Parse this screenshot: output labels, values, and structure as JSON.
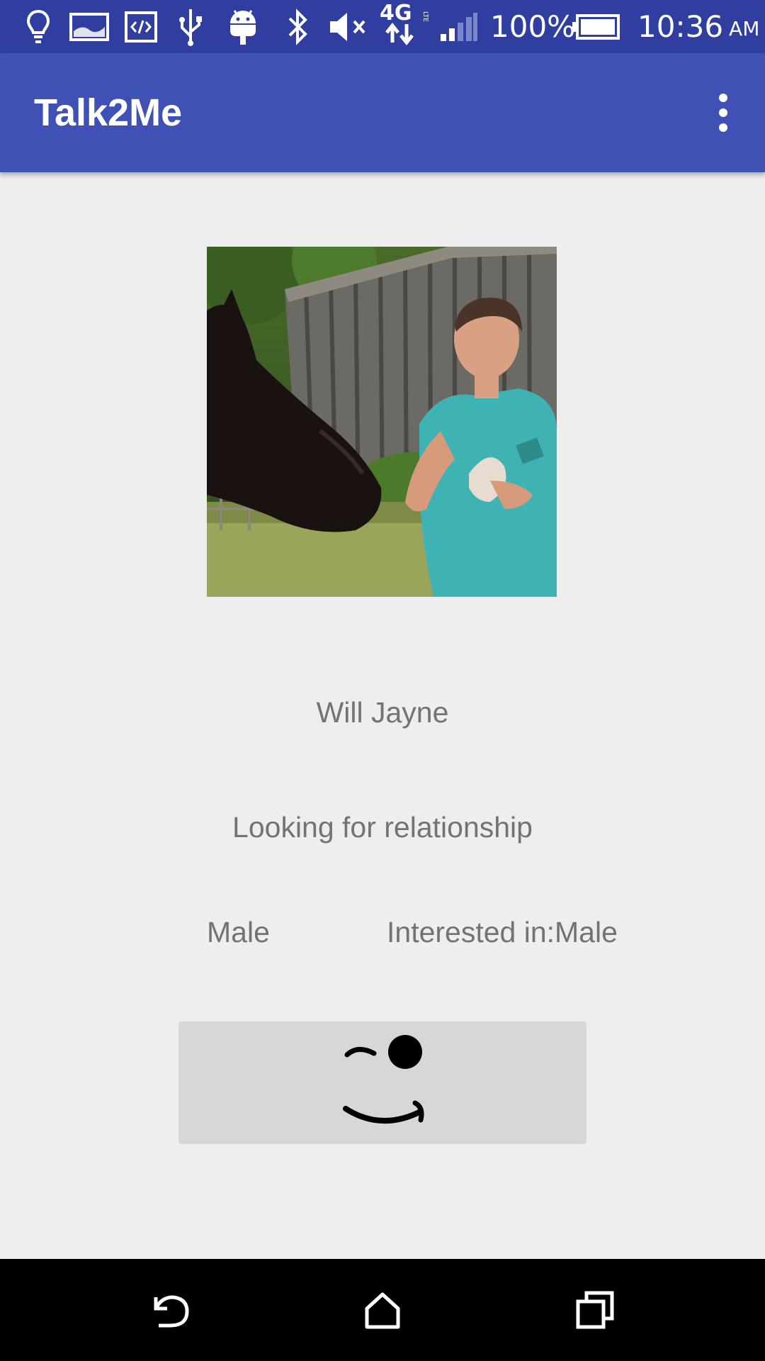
{
  "status_bar": {
    "battery_percent": "100%",
    "time": "10:36",
    "time_suffix": "AM",
    "network": "4G",
    "network_sub": "LTE",
    "icons": [
      "lightbulb-icon",
      "image-icon",
      "code-icon",
      "usb-icon",
      "android-icon",
      "bluetooth-icon",
      "mute-icon",
      "network-4g-lte-icon",
      "signal-icon",
      "battery-icon"
    ]
  },
  "app_bar": {
    "title": "Talk2Me",
    "menu_icon": "more-vert-icon"
  },
  "profile": {
    "photo_alt": "profile photo",
    "name": "Will Jayne",
    "status": "Looking for relationship",
    "gender": "Male",
    "interested_in": "Interested in:Male"
  },
  "actions": {
    "wink_icon": "wink-face-icon"
  },
  "nav_bar": {
    "icons": [
      "back-icon",
      "home-icon",
      "recents-icon"
    ]
  },
  "colors": {
    "status_bar": "#303f9f",
    "app_bar": "#3f51b5",
    "background": "#eeeeee",
    "text_secondary": "#737373",
    "button_bg": "#d6d7d7"
  }
}
